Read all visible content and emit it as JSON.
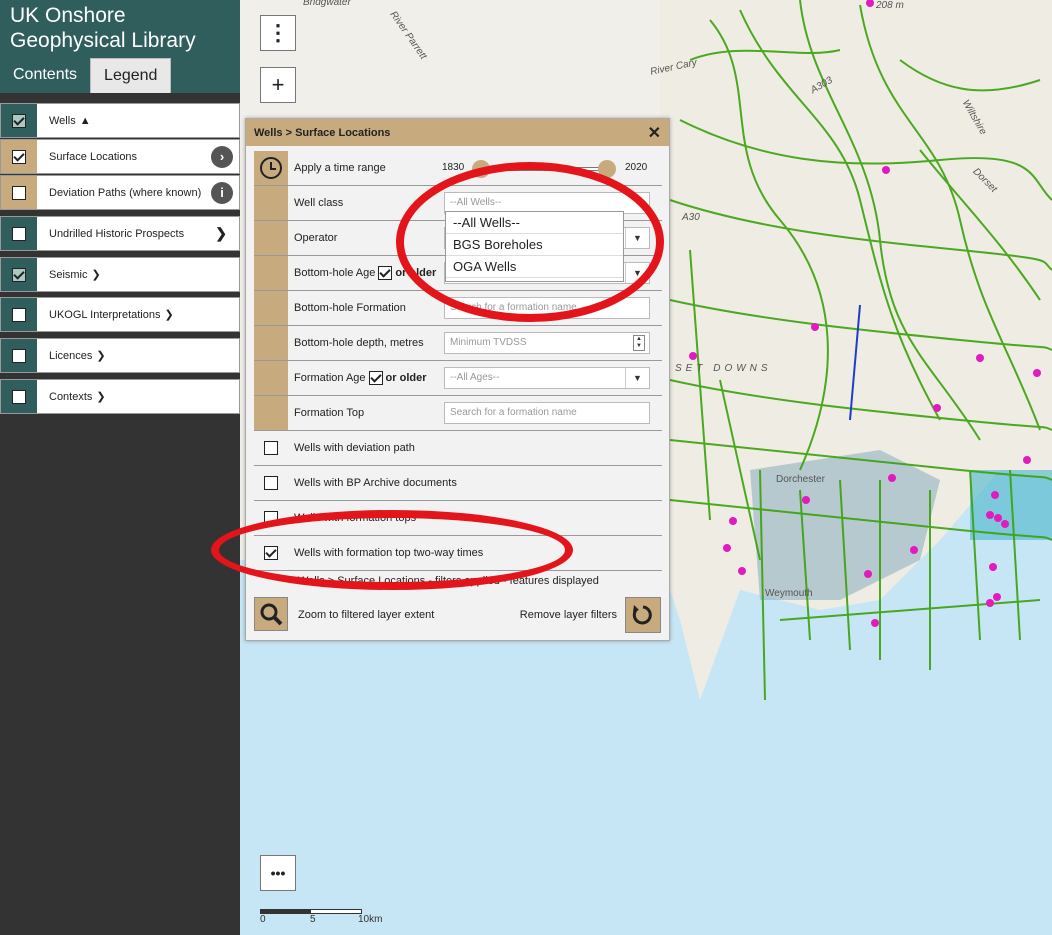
{
  "app": {
    "title_line1": "UK Onshore",
    "title_line2": "Geophysical Library",
    "tabs": [
      {
        "label": "Contents",
        "active": false
      },
      {
        "label": "Legend",
        "active": true
      }
    ]
  },
  "layers": [
    {
      "label": "Wells",
      "chevron": "up",
      "checked": true
    },
    {
      "label": "Surface Locations",
      "checked": true,
      "right": "arrow-circle"
    },
    {
      "label": "Deviation Paths (where known)",
      "checked": false,
      "right": "info"
    },
    {
      "label": "Undrilled Historic Prospects",
      "checked": false,
      "right": "chevron-right"
    },
    {
      "label": "Seismic",
      "chevron": "down",
      "checked": true
    },
    {
      "label": "UKOGL Interpretations",
      "chevron": "down",
      "checked": false
    },
    {
      "label": "Licences",
      "chevron": "down",
      "checked": false
    },
    {
      "label": "Contexts",
      "chevron": "down",
      "checked": false
    }
  ],
  "map": {
    "labels": {
      "bridgwater": "Bridgwater",
      "river_parrett": "River Parrett",
      "river_cary": "River Cary",
      "a303": "A303",
      "a30": "A30",
      "wiltshire": "Wiltshire",
      "dorset": "Dorset",
      "downs": "SET DOWNS",
      "dorchester": "Dorchester",
      "weymouth": "Weymouth",
      "elev": "208 m"
    },
    "scale": {
      "t0": "0",
      "t1": "5",
      "t2": "10km"
    },
    "controls": {
      "menu": "⋮",
      "zoom_in": "+",
      "more": "•••"
    }
  },
  "panel": {
    "title": "Wells > Surface Locations",
    "close": "✕",
    "time_range": {
      "label": "Apply a time range",
      "from": "1830",
      "to": "2020"
    },
    "well_class": {
      "label": "Well class",
      "value": "--All Wells--"
    },
    "well_class_options": [
      "--All Wells--",
      "BGS Boreholes",
      "OGA Wells"
    ],
    "operator": {
      "label": "Operator"
    },
    "bottom_hole_age": {
      "label": "Bottom-hole Age",
      "suffix": "or older"
    },
    "bottom_hole_formation": {
      "label": "Bottom-hole Formation",
      "placeholder": "Search for a formation name"
    },
    "bottom_hole_depth": {
      "label": "Bottom-hole depth, metres",
      "placeholder": "Minimum TVDSS"
    },
    "formation_age": {
      "label": "Formation Age",
      "suffix": "or older",
      "value": "--All Ages--"
    },
    "formation_top": {
      "label": "Formation Top",
      "placeholder": "Search for a formation name"
    },
    "deviation": {
      "label": "Wells with deviation path"
    },
    "bp_archive": {
      "label": "Wells with BP Archive documents"
    },
    "formation_tops": {
      "label": "Wells with formation tops"
    },
    "twt": {
      "label": "Wells with formation top two-way times"
    },
    "status": "Wells > Surface Locations - filters applied - features displayed",
    "zoom_label": "Zoom to filtered layer extent",
    "remove_label": "Remove layer filters"
  }
}
